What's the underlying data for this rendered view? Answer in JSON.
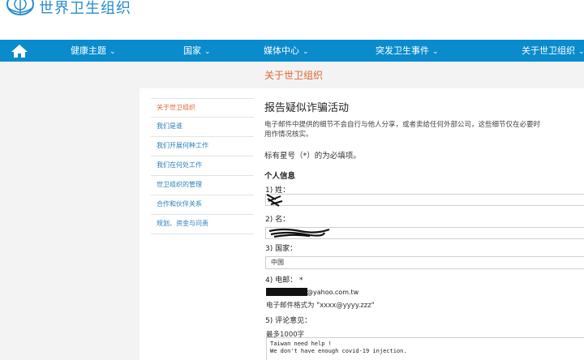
{
  "brand": {
    "name": "世界卫生组织",
    "accent": "#0a8bcc",
    "header_accent": "#e0662f"
  },
  "nav": {
    "home_icon": "home-icon",
    "items": [
      {
        "label": "健康主题"
      },
      {
        "label": "国家"
      },
      {
        "label": "媒体中心"
      },
      {
        "label": "突发卫生事件"
      },
      {
        "label": "关于世卫组织"
      }
    ]
  },
  "header": {
    "title": "关于世卫组织"
  },
  "sidebar": {
    "items": [
      {
        "label": "关于世卫组织",
        "active": true
      },
      {
        "label": "我们是谁"
      },
      {
        "label": "我们开展何种工作"
      },
      {
        "label": "我们在何处工作"
      },
      {
        "label": "世卫组织的管理"
      },
      {
        "label": "合作和伙伴关系"
      },
      {
        "label": "规划、资金与问责"
      }
    ]
  },
  "form": {
    "title": "报告疑似诈骗活动",
    "intro": "电子邮件中提供的细节不会自行与他人分享，或者卖给任何外部公司，这些细节仅在必要时用作情况核实。",
    "required_note": "标有星号（*）的为必填项。",
    "section": "个人信息",
    "fields": {
      "surname_label": "1) 姓：",
      "given_name_label": "2) 名：",
      "country_label": "3) 国家：",
      "country_value": "中国",
      "email_label": "4) 电邮：",
      "email_required": "*",
      "email_suffix": "@yahoo.com.tw",
      "email_hint": "电子邮件格式为 \"xxxx@yyyy.zzz\"",
      "comment_label": "5) 评论意见：",
      "comment_max": "最多1000字",
      "comment_value": "Taiwan need help !\nWe don't have enough covid-19 injection."
    }
  }
}
